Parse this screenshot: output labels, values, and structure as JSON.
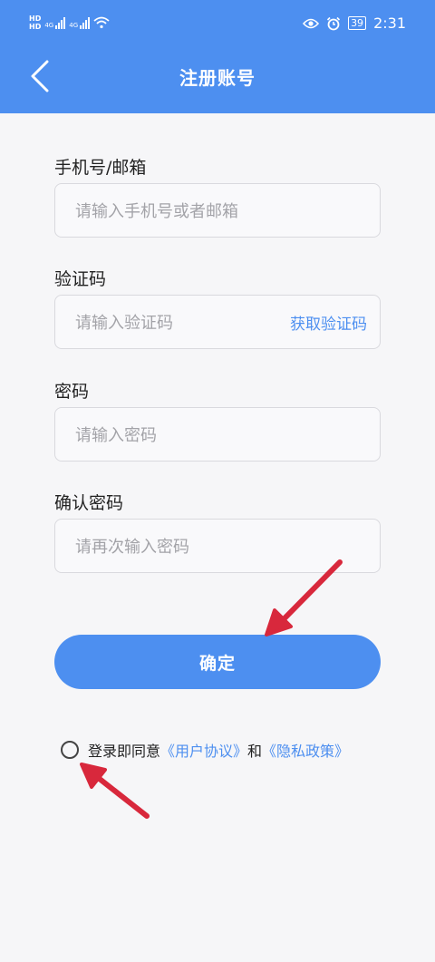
{
  "status_bar": {
    "hd1": "HD",
    "hd2": "HD",
    "net1": "4G",
    "net2": "4G",
    "battery": "39",
    "time": "2:31"
  },
  "header": {
    "title": "注册账号"
  },
  "form": {
    "phone": {
      "label": "手机号/邮箱",
      "placeholder": "请输入手机号或者邮箱"
    },
    "code": {
      "label": "验证码",
      "placeholder": "请输入验证码",
      "action": "获取验证码"
    },
    "password": {
      "label": "密码",
      "placeholder": "请输入密码"
    },
    "confirm_password": {
      "label": "确认密码",
      "placeholder": "请再次输入密码"
    },
    "submit_label": "确定"
  },
  "agreement": {
    "prefix": "登录即同意",
    "user_agreement": "《用户协议》",
    "conjunction": "和",
    "privacy_policy": "《隐私政策》",
    "checked": false
  },
  "colors": {
    "accent": "#4d8ff0",
    "annotation_arrow": "#d8283c",
    "background": "#f6f6f8"
  }
}
